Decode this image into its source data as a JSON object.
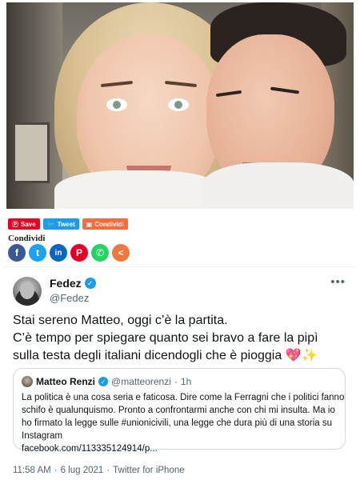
{
  "share_bar": {
    "buttons": [
      {
        "label": "Save",
        "icon": "pinterest-icon",
        "color": "#e60023"
      },
      {
        "label": "Tweet",
        "icon": "twitter-icon",
        "color": "#1d9bf0"
      },
      {
        "label": "Condividi",
        "icon": "share-icon",
        "color": "#ff6a3d"
      }
    ]
  },
  "share_section": {
    "label": "Condividi",
    "icons": [
      {
        "name": "facebook-icon",
        "glyph": "f",
        "color": "#3b5998"
      },
      {
        "name": "twitter-icon",
        "glyph": "t",
        "color": "#1da1f2"
      },
      {
        "name": "linkedin-icon",
        "glyph": "in",
        "color": "#0a66c2"
      },
      {
        "name": "pinterest-icon",
        "glyph": "P",
        "color": "#e60023"
      },
      {
        "name": "whatsapp-icon",
        "glyph": "✆",
        "color": "#25d366"
      },
      {
        "name": "share-icon",
        "glyph": "<",
        "color": "#f0783c"
      }
    ]
  },
  "tweet": {
    "display_name": "Fedez",
    "handle": "@Fedez",
    "more": "•••",
    "lines": [
      "Stai sereno Matteo, oggi c’è la partita.",
      "C’è tempo per spiegare quanto sei bravo a fare la pipì",
      "sulla testa degli italiani dicendogli che è pioggia 💖✨"
    ],
    "quote": {
      "name": "Matteo Renzi",
      "handle": "@matteorenzi",
      "dot": "·",
      "time": "1h",
      "lines": [
        "La politica è una cosa seria e faticosa. Dire come la Ferragni che i politici fanno",
        "schifo è qualunquismo. Pronto a confrontarmi anche con chi mi insulta. Ma io",
        "ho firmato la legge sulle #unionicivili, una legge che dura più di una storia su",
        "Instagram",
        "facebook.com/113335124914/p..."
      ]
    },
    "meta": {
      "time": "11:58 AM",
      "dot1": "·",
      "date": "6 lug 2021",
      "dot2": "·",
      "source": "Twitter for iPhone"
    }
  },
  "colors": {
    "verified": "#1d9bf0",
    "secondary_text": "#536471"
  }
}
